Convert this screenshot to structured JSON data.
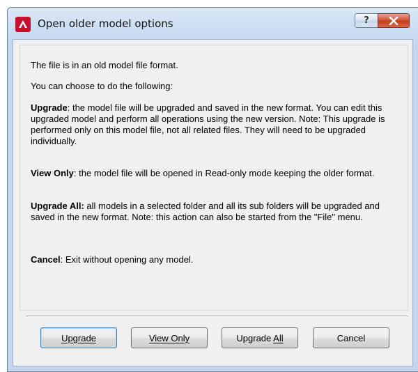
{
  "window": {
    "title": "Open older model options",
    "help_glyph": "?",
    "close_glyph": "✕"
  },
  "colors": {
    "app_icon": "#c8102e",
    "close_button": "#c43b17",
    "default_button_border": "#3c7fb1"
  },
  "message": {
    "intro": "The file is in an old model file format.",
    "choose": "You can choose to do the following:",
    "options": [
      {
        "term": "Upgrade",
        "text": ": the model file will be upgraded and saved in the new format. You can edit this upgraded model and perform all operations using the new version. Note: This upgrade is performed only on this model file, not all related files.  They will need to be upgraded individually."
      },
      {
        "term": "View Only",
        "text": ": the model file will be opened in Read-only mode keeping the older format."
      },
      {
        "term": "Upgrade All:",
        "text": " all models in a selected folder and all its sub folders will be upgraded and saved in the new format. Note: this action can also be started from the \"File\" menu."
      },
      {
        "term": "Cancel",
        "text": ": Exit without opening any model."
      }
    ]
  },
  "buttons": {
    "upgrade": "Upgrade",
    "view_only": "View Only",
    "upgrade_all_prefix": "Upgrade ",
    "upgrade_all_mnemonic": "All",
    "cancel": "Cancel"
  }
}
